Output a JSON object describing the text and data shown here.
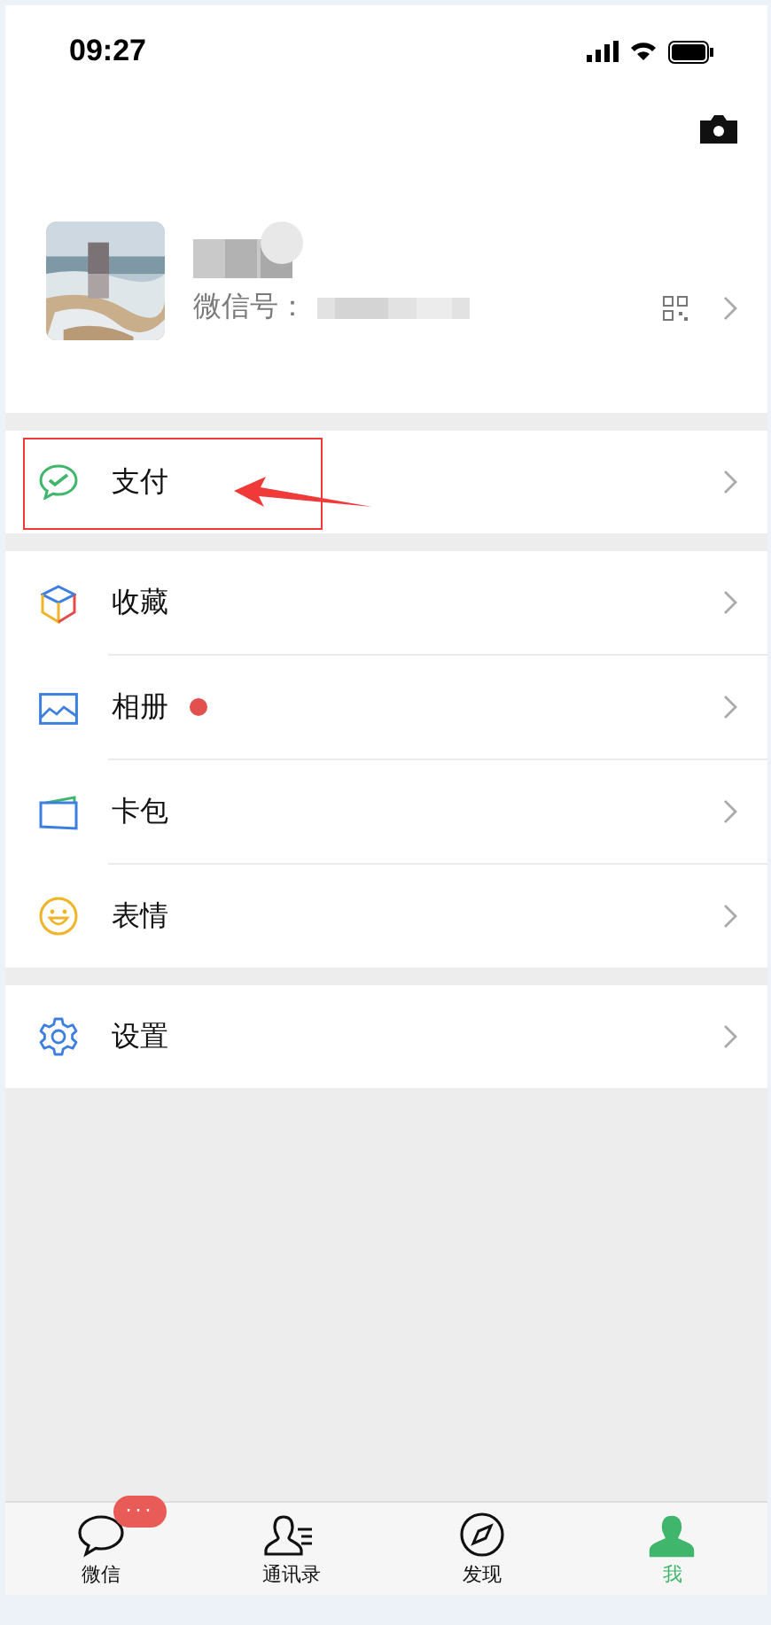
{
  "status_bar": {
    "time": "09:27"
  },
  "profile": {
    "id_label": "微信号："
  },
  "menu_groups": [
    [
      {
        "kind": "pay",
        "label": "支付",
        "badge": false,
        "highlighted": true
      }
    ],
    [
      {
        "kind": "favorites",
        "label": "收藏",
        "badge": false,
        "highlighted": false
      },
      {
        "kind": "album",
        "label": "相册",
        "badge": true,
        "highlighted": false
      },
      {
        "kind": "cards",
        "label": "卡包",
        "badge": false,
        "highlighted": false
      },
      {
        "kind": "stickers",
        "label": "表情",
        "badge": false,
        "highlighted": false
      }
    ],
    [
      {
        "kind": "settings",
        "label": "设置",
        "badge": false,
        "highlighted": false
      }
    ]
  ],
  "tabs": [
    {
      "kind": "chats",
      "label": "微信",
      "selected": false,
      "badge": "···"
    },
    {
      "kind": "contacts",
      "label": "通讯录",
      "selected": false
    },
    {
      "kind": "discover",
      "label": "发现",
      "selected": false
    },
    {
      "kind": "me",
      "label": "我",
      "selected": true
    }
  ]
}
